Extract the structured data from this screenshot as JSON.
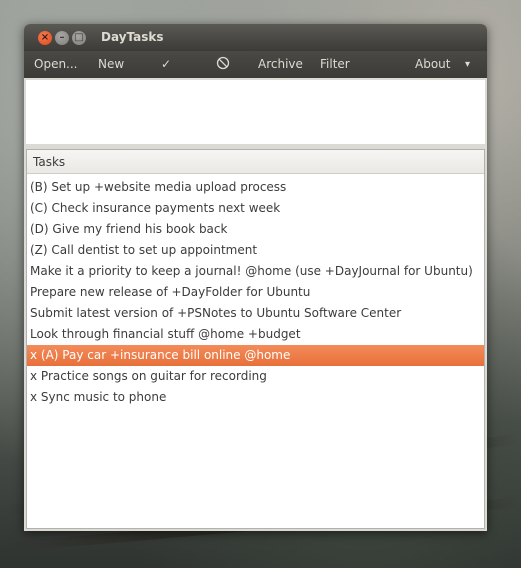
{
  "window": {
    "title": "DayTasks",
    "close_glyph": "×",
    "minimize_glyph": "–",
    "maximize_glyph": "□"
  },
  "menubar": {
    "open_label": "Open...",
    "new_label": "New",
    "complete_label": "✓",
    "cancel_label": "⃠",
    "archive_label": "Archive",
    "filter_label": "Filter",
    "about_label": "About",
    "dropdown_label": "▾"
  },
  "tasks": {
    "header": "Tasks",
    "selected_index": 8,
    "items": [
      "(B) Set up +website media upload process",
      "(C) Check insurance payments next week",
      "(D) Give my friend his book back",
      "(Z) Call dentist to set up appointment",
      "Make it a priority to keep a journal! @home (use +DayJournal for Ubuntu)",
      "Prepare new release of +DayFolder for Ubuntu",
      "Submit latest version of +PSNotes to Ubuntu Software Center",
      "Look through financial stuff @home +budget",
      "x (A) Pay car +insurance bill online @home",
      "x Practice songs on guitar for recording",
      "x Sync music to phone"
    ]
  },
  "colors": {
    "titlebar": "#3c3b37",
    "selection": "#e8703a",
    "close_button": "#df4a16"
  }
}
